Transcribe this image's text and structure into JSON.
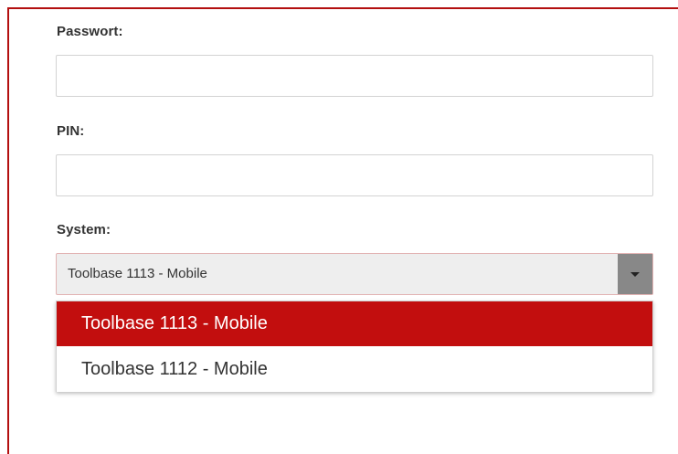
{
  "form": {
    "password_label": "Passwort:",
    "password_value": "",
    "pin_label": "PIN:",
    "pin_value": "",
    "system_label": "System:",
    "system_selected": "Toolbase 1113 - Mobile"
  },
  "dropdown": {
    "options": [
      {
        "label": "Toolbase 1113 - Mobile",
        "selected": true
      },
      {
        "label": "Toolbase 1112 - Mobile",
        "selected": false
      }
    ]
  },
  "colors": {
    "accent": "#c20e0e",
    "border_accent": "#b30f0f",
    "arrow_bg": "#888888"
  },
  "icons": {
    "select_arrow": "chevron-down-icon"
  }
}
